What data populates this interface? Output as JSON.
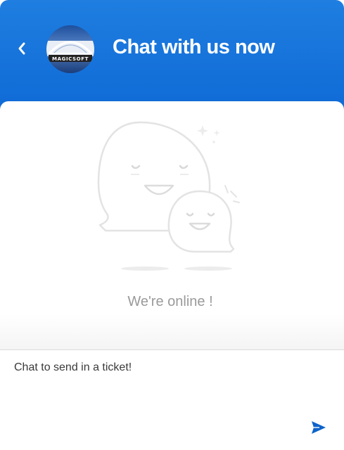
{
  "header": {
    "title": "Chat with us now",
    "back_icon": "chevron-left-icon",
    "avatar": {
      "logo_text": "MAGICSOFT"
    },
    "color": "#1577dc"
  },
  "main": {
    "illustration": "smiling-chat-bubbles-illustration",
    "status_text": "We're online !"
  },
  "composer": {
    "placeholder": "Chat to send in a ticket!",
    "value": "",
    "send_icon": "send-icon",
    "send_color": "#0d63c9"
  }
}
